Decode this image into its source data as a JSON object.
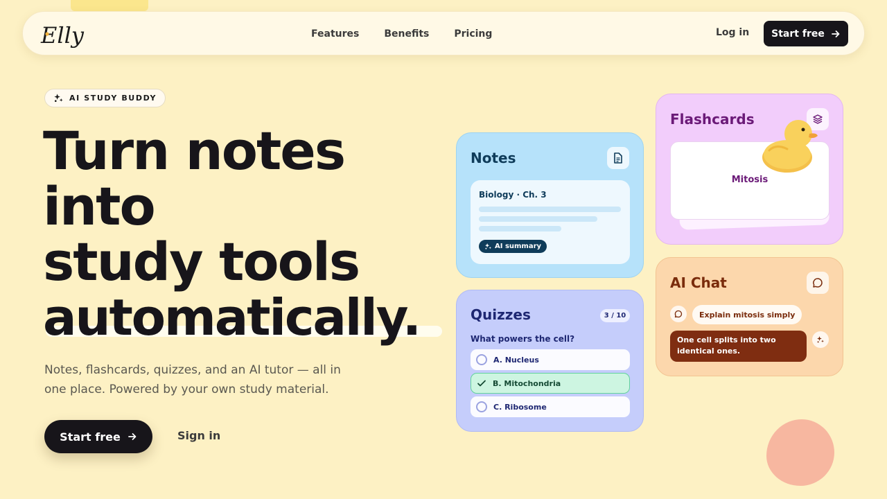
{
  "nav": {
    "brand": "Elly",
    "links": [
      "Features",
      "Benefits",
      "Pricing"
    ],
    "login": "Log in",
    "cta": "Start free",
    "cta_icon": "arrow-right-icon"
  },
  "hero": {
    "badge": "AI STUDY BUDDY",
    "badge_icon": "sparkles-icon",
    "headline": [
      "Turn notes",
      "into",
      "study tools",
      "automatically."
    ],
    "subtitle": "Notes, flashcards, quizzes, and an AI tutor — all in one place. Powered by your own study material.",
    "cta": "Start free",
    "signin": "Sign in"
  },
  "cards": {
    "notes": {
      "title": "Notes",
      "icon": "document-icon",
      "subject": "Biology · Ch. 3",
      "pill": "AI summary"
    },
    "quizzes": {
      "title": "Quizzes",
      "count": "3 / 10",
      "question": "What powers the cell?",
      "options": [
        "A. Nucleus",
        "B. Mitochondria",
        "C. Ribosome"
      ],
      "selected_index": 1
    },
    "flashcards": {
      "title": "Flashcards",
      "icon": "layers-icon",
      "term": "Mitosis"
    },
    "chat": {
      "title": "AI Chat",
      "icon": "chat-bubble-icon",
      "user_message": "Explain mitosis simply",
      "ai_message": "One cell splits into two identical ones."
    }
  },
  "colors": {
    "background": "#fdf1c4",
    "dark": "#17151a",
    "notes": "#b6e2fa",
    "quizzes": "#c5cdfb",
    "flashcards": "#f2cdfb",
    "chat": "#fcd7ac"
  }
}
